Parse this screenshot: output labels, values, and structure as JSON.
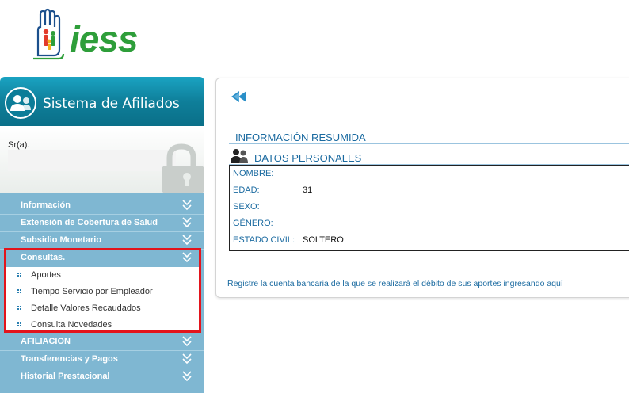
{
  "brand": {
    "name": "IESS",
    "logo_text": "iess",
    "color": "#2e9e3a"
  },
  "sidebar": {
    "system_title": "Sistema de Afiliados",
    "greeting": "Sr(a).",
    "menu": [
      {
        "label": "Información",
        "expanded": false
      },
      {
        "label": "Extensión de Cobertura de Salud",
        "expanded": false
      },
      {
        "label": "Subsidio Monetario",
        "expanded": false
      },
      {
        "label": "Consultas.",
        "expanded": true
      },
      {
        "label": "AFILIACION",
        "expanded": false
      },
      {
        "label": "Transferencias y Pagos",
        "expanded": false
      },
      {
        "label": "Historial Prestacional",
        "expanded": false
      }
    ],
    "submenu": [
      {
        "label": "Aportes"
      },
      {
        "label": "Tiempo Servicio por Empleador"
      },
      {
        "label": "Detalle Valores Recaudados"
      },
      {
        "label": "Consulta Novedades"
      }
    ],
    "highlight_color": "#e3141c"
  },
  "main": {
    "back_icon": "rewind-icon",
    "section_title": "INFORMACIÓN RESUMIDA",
    "personal_title": "DATOS PERSONALES",
    "fields": [
      {
        "key": "NOMBRE:",
        "value": ""
      },
      {
        "key": "EDAD:",
        "value": "31"
      },
      {
        "key": "SEXO:",
        "value": ""
      },
      {
        "key": "GÉNERO:",
        "value": ""
      },
      {
        "key": "ESTADO CIVIL:",
        "value": "SOLTERO"
      }
    ],
    "bank_link": "Registre la cuenta bancaria de la que se realizará el débito de sus aportes ingresando aquí"
  },
  "colors": {
    "accent_blue": "#1a6aa0",
    "menu_bg": "#7fb7d2",
    "header_bg": "#0f7f9a"
  }
}
